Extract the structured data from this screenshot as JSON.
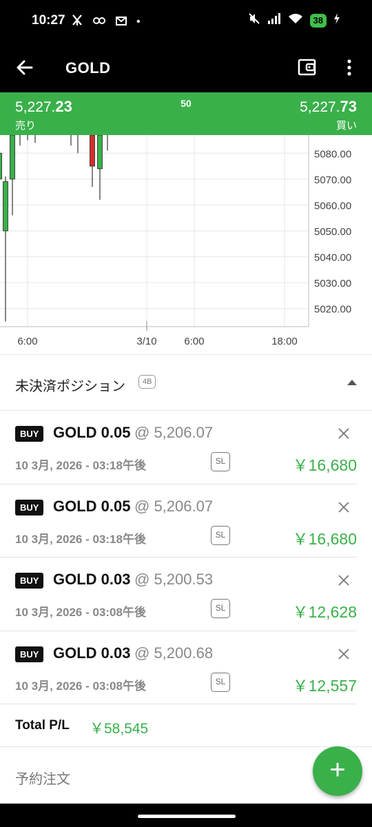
{
  "status_bar": {
    "time": "10:27",
    "left_icons": [
      "notification-icon",
      "loop-icon",
      "mail-icon"
    ],
    "dot": "•",
    "battery": "38"
  },
  "app_bar": {
    "title": "GOLD"
  },
  "quote": {
    "bid_main": "5,227.",
    "bid_decimal": "23",
    "bid_label": "売り",
    "spread": "50",
    "ask_main": "5,227.",
    "ask_decimal": "73",
    "ask_label": "買い"
  },
  "chart_data": {
    "type": "candlestick",
    "y_ticks": [
      "5080.00",
      "5070.00",
      "5060.00",
      "5050.00",
      "5040.00",
      "5030.00",
      "5020.00"
    ],
    "x_ticks": [
      "6:00",
      "3/10",
      "6:00",
      "18:00"
    ],
    "ylim": [
      5013,
      5087
    ],
    "candles": [
      {
        "o": 5070,
        "c": 5080,
        "h": 5087,
        "l": 5058,
        "color": "green"
      },
      {
        "o": 5050,
        "c": 5069,
        "h": 5071,
        "l": 5015,
        "color": "green"
      },
      {
        "o": 5070,
        "c": 5087,
        "h": 5087,
        "l": 5056,
        "color": "green"
      },
      {
        "o": 5087,
        "c": 5087,
        "h": 5087,
        "l": 5083,
        "color": "tick"
      },
      {
        "o": 5087,
        "c": 5087,
        "h": 5087,
        "l": 5085,
        "color": "tick"
      },
      {
        "o": 5087,
        "c": 5087,
        "h": 5087,
        "l": 5084,
        "color": "tick"
      },
      {
        "o": 5087,
        "c": 5087,
        "h": 5087,
        "l": 5083,
        "color": "tick"
      },
      {
        "o": 5087,
        "c": 5087,
        "h": 5087,
        "l": 5080,
        "color": "tick"
      },
      {
        "o": 5087,
        "c": 5075,
        "h": 5087,
        "l": 5067,
        "color": "red"
      },
      {
        "o": 5074,
        "c": 5087,
        "h": 5087,
        "l": 5062,
        "color": "green"
      },
      {
        "o": 5087,
        "c": 5087,
        "h": 5087,
        "l": 5081,
        "color": "tick"
      }
    ],
    "colors": {
      "up": "#3ab04a",
      "down": "#d32f2f",
      "grid": "#e6e6e6"
    }
  },
  "positions_section": {
    "title": "未決済ポジション",
    "count_badge": "4B"
  },
  "positions": [
    {
      "side": "BUY",
      "symbol": "GOLD 0.05",
      "price": "@ 5,206.07",
      "timestamp": "10 3月, 2026 - 03:18午後",
      "sl": "SL",
      "pl": "￥16,680"
    },
    {
      "side": "BUY",
      "symbol": "GOLD 0.05",
      "price": "@ 5,206.07",
      "timestamp": "10 3月, 2026 - 03:18午後",
      "sl": "SL",
      "pl": "￥16,680"
    },
    {
      "side": "BUY",
      "symbol": "GOLD 0.03",
      "price": "@ 5,200.53",
      "timestamp": "10 3月, 2026 - 03:08午後",
      "sl": "SL",
      "pl": "￥12,628"
    },
    {
      "side": "BUY",
      "symbol": "GOLD 0.03",
      "price": "@ 5,200.68",
      "timestamp": "10 3月, 2026 - 03:08午後",
      "sl": "SL",
      "pl": "￥12,557"
    }
  ],
  "total": {
    "label": "Total P/L",
    "value": "￥58,545"
  },
  "pending": {
    "label": "予約注文"
  },
  "fab": {
    "symbol": "+"
  },
  "colors": {
    "accent": "#3ab04a",
    "loss": "#d32f2f"
  }
}
